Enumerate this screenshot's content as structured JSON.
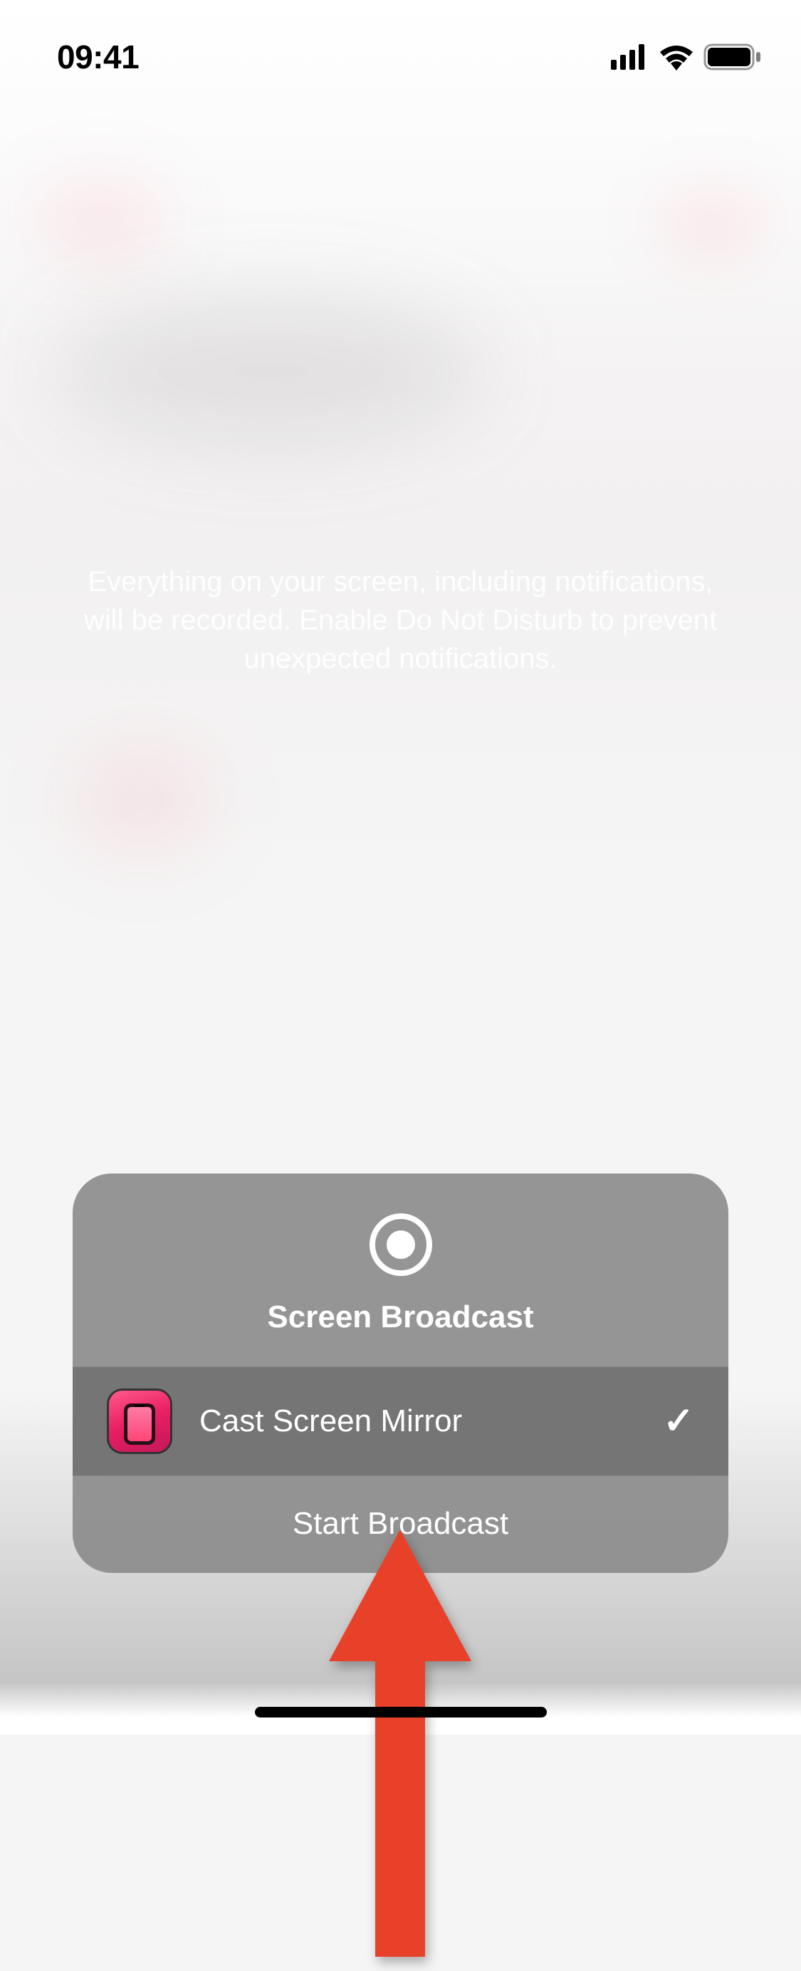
{
  "status_bar": {
    "time": "09:41"
  },
  "info_text": "Everything on your screen, including notifications, will be recorded. Enable Do Not Disturb to prevent unexpected notifications.",
  "modal": {
    "title": "Screen Broadcast",
    "app_name": "Cast Screen Mirror",
    "start_button": "Start Broadcast"
  },
  "colors": {
    "arrow": "#e8412a"
  }
}
